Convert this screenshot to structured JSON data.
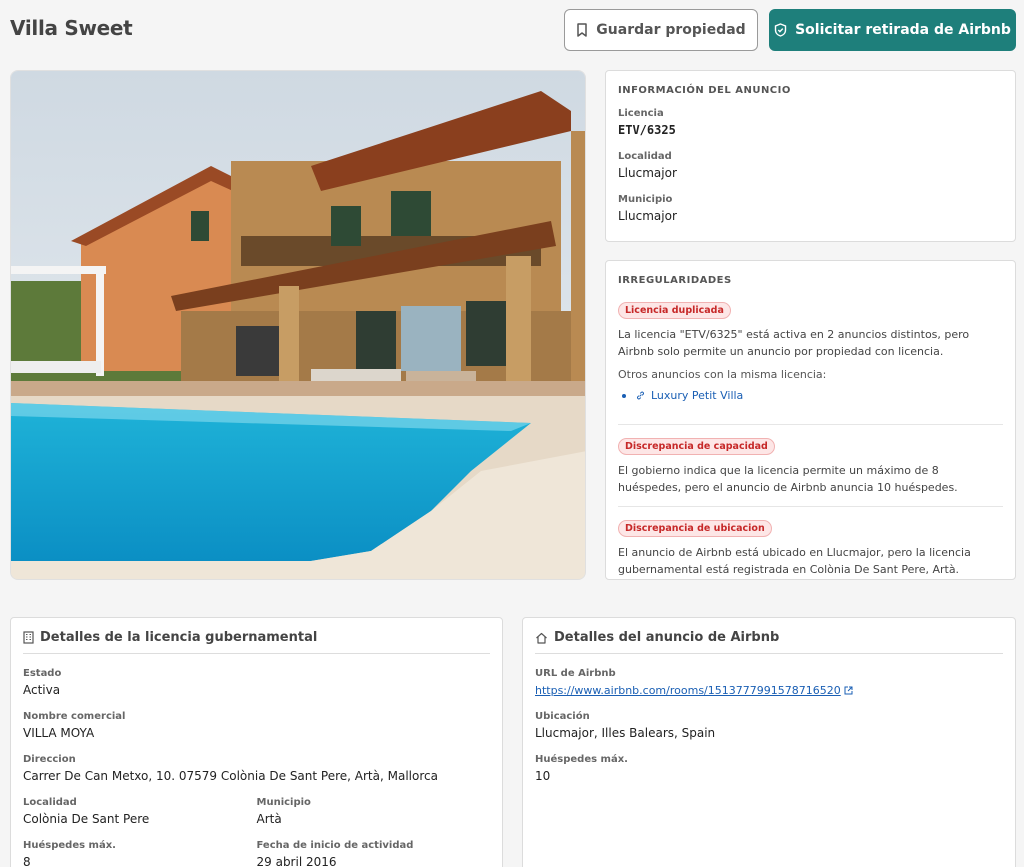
{
  "header": {
    "title": "Villa Sweet",
    "save_label": "Guardar propiedad",
    "remove_label": "Solicitar retirada de Airbnb"
  },
  "listing_info": {
    "heading": "INFORMACIÓN DEL ANUNCIO",
    "fields": [
      {
        "label": "Licencia",
        "value": "ETV/6325"
      },
      {
        "label": "Localidad",
        "value": "Llucmajor"
      },
      {
        "label": "Municipio",
        "value": "Llucmajor"
      }
    ]
  },
  "irregularities": {
    "heading": "IRREGULARIDADES",
    "items": [
      {
        "badge": "Licencia duplicada",
        "text": "La licencia \"ETV/6325\" está activa en 2 anuncios distintos, pero Airbnb solo permite un anuncio por propiedad con licencia.",
        "sub": "Otros anuncios con la misma licencia:",
        "links": [
          "Luxury Petit Villa"
        ]
      },
      {
        "badge": "Discrepancia de capacidad",
        "text": "El gobierno indica que la licencia permite un máximo de 8 huéspedes, pero el anuncio de Airbnb anuncia 10 huéspedes."
      },
      {
        "badge": "Discrepancia de ubicacion",
        "text": "El anuncio de Airbnb está ubicado en Llucmajor, pero la licencia gubernamental está registrada en Colònia De Sant Pere, Artà."
      }
    ]
  },
  "gov_license": {
    "heading": "Detalles de la licencia gubernamental",
    "estado_label": "Estado",
    "estado": "Activa",
    "nombre_label": "Nombre comercial",
    "nombre": "VILLA MOYA",
    "direccion_label": "Direccion",
    "direccion": "Carrer De Can Metxo, 10. 07579 Colònia De Sant Pere, Artà, Mallorca",
    "localidad_label": "Localidad",
    "localidad": "Colònia De Sant Pere",
    "municipio_label": "Municipio",
    "municipio": "Artà",
    "huespedes_label": "Huéspedes máx.",
    "huespedes": "8",
    "fecha_label": "Fecha de inicio de actividad",
    "fecha": "29 abril 2016"
  },
  "airbnb_listing": {
    "heading": "Detalles del anuncio de Airbnb",
    "url_label": "URL de Airbnb",
    "url": "https://www.airbnb.com/rooms/1513777991578716520",
    "ubicacion_label": "Ubicación",
    "ubicacion": "Llucmajor, Illes Balears, Spain",
    "huespedes_label": "Huéspedes máx.",
    "huespedes": "10"
  },
  "colors": {
    "accent": "#1e7f7b",
    "badge_red": "#c62828",
    "link": "#1a5fb4"
  }
}
